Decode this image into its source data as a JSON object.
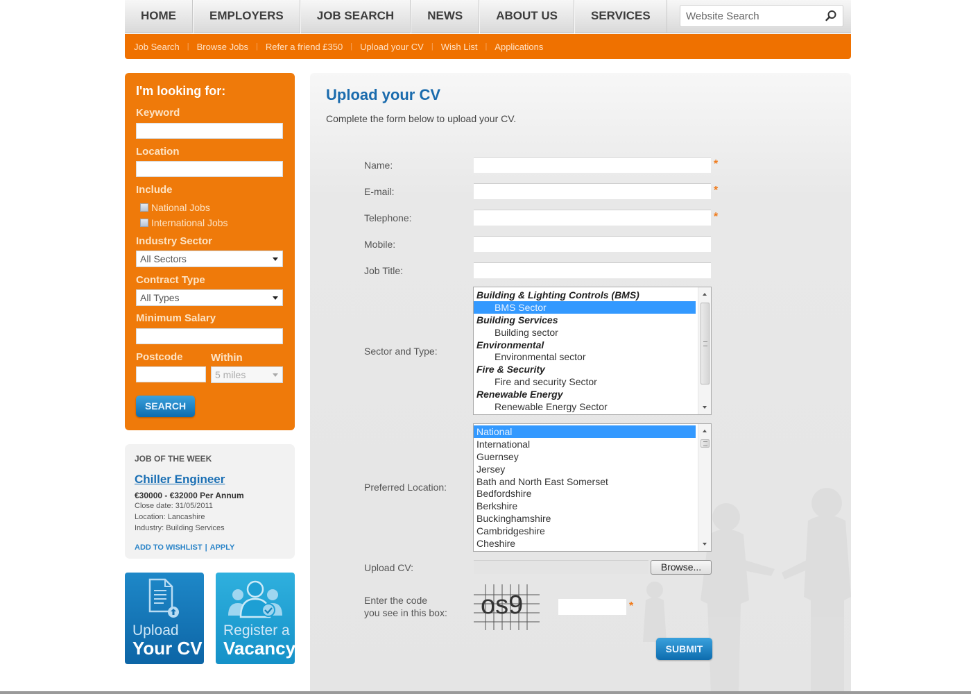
{
  "topnav": {
    "items": [
      {
        "label": "HOME"
      },
      {
        "label": "EMPLOYERS"
      },
      {
        "label": "JOB SEARCH"
      },
      {
        "label": "NEWS"
      },
      {
        "label": "ABOUT US"
      },
      {
        "label": "SERVICES"
      }
    ],
    "search": {
      "placeholder": "Website Search",
      "value": "",
      "icon": "search-icon"
    }
  },
  "subnav": {
    "items": [
      {
        "label": "Job Search"
      },
      {
        "label": "Browse Jobs"
      },
      {
        "label": "Refer a friend £350"
      },
      {
        "label": "Upload your CV"
      },
      {
        "label": "Wish List"
      },
      {
        "label": "Applications"
      }
    ]
  },
  "search_panel": {
    "title": "I'm looking for:",
    "keyword": {
      "label": "Keyword",
      "value": ""
    },
    "location": {
      "label": "Location",
      "value": ""
    },
    "include": {
      "label": "Include",
      "options": [
        {
          "label": "National Jobs",
          "checked": false
        },
        {
          "label": "International Jobs",
          "checked": false
        }
      ]
    },
    "industry_sector": {
      "label": "Industry Sector",
      "selected": "All Sectors"
    },
    "contract_type": {
      "label": "Contract Type",
      "selected": "All Types"
    },
    "minimum_salary": {
      "label": "Minimum Salary",
      "value": ""
    },
    "postcode": {
      "label": "Postcode",
      "value": ""
    },
    "within": {
      "label": "Within",
      "selected": "5 miles"
    },
    "search_button": "SEARCH"
  },
  "job_of_the_week": {
    "heading": "JOB OF THE WEEK",
    "title": "Chiller Engineer",
    "salary": "€30000 - €32000 Per Annum",
    "close_date": "Close date: 31/05/2011",
    "location": "Location: Lancashire",
    "industry": "Industry: Building Services",
    "add_to_wishlist": "ADD TO WISHLIST",
    "separator": "|",
    "apply": "APPLY"
  },
  "tiles": {
    "upload": {
      "line1": "Upload",
      "line2": "Your CV",
      "icon": "document-upload-icon"
    },
    "register": {
      "line1": "Register a",
      "line2": "Vacancy",
      "icon": "people-check-icon"
    }
  },
  "form": {
    "title": "Upload your CV",
    "intro": "Complete the form below to upload your CV.",
    "required_marker": "*",
    "fields": {
      "name": {
        "label": "Name:",
        "value": "",
        "required": true
      },
      "email": {
        "label": "E-mail:",
        "value": "",
        "required": true
      },
      "telephone": {
        "label": "Telephone:",
        "value": "",
        "required": true
      },
      "mobile": {
        "label": "Mobile:",
        "value": "",
        "required": false
      },
      "job_title": {
        "label": "Job Title:",
        "value": "",
        "required": false
      }
    },
    "sector": {
      "label": "Sector and Type:",
      "options": [
        {
          "label": "Building & Lighting Controls (BMS)",
          "group": true
        },
        {
          "label": "BMS Sector",
          "group": false,
          "selected": true
        },
        {
          "label": "Building Services",
          "group": true
        },
        {
          "label": "Building sector",
          "group": false
        },
        {
          "label": "Environmental",
          "group": true
        },
        {
          "label": "Environmental sector",
          "group": false
        },
        {
          "label": "Fire & Security",
          "group": true
        },
        {
          "label": "Fire and security Sector",
          "group": false
        },
        {
          "label": "Renewable Energy",
          "group": true
        },
        {
          "label": "Renewable Energy Sector",
          "group": false
        }
      ]
    },
    "location": {
      "label": "Preferred Location:",
      "options": [
        {
          "label": "National",
          "selected": true
        },
        {
          "label": "International"
        },
        {
          "label": "Guernsey"
        },
        {
          "label": "Jersey"
        },
        {
          "label": "Bath and North East Somerset"
        },
        {
          "label": "Bedfordshire"
        },
        {
          "label": "Berkshire"
        },
        {
          "label": "Buckinghamshire"
        },
        {
          "label": "Cambridgeshire"
        },
        {
          "label": "Cheshire"
        }
      ]
    },
    "upload": {
      "label": "Upload CV:",
      "value": "",
      "browse_button": "Browse..."
    },
    "captcha": {
      "label_line1": "Enter the code",
      "label_line2": "you see in this box:",
      "code": "os9",
      "value": "",
      "required": true
    },
    "submit_button": "SUBMIT"
  },
  "colors": {
    "brand_orange": "#ef7100",
    "brand_blue": "#1a6bad",
    "button_blue": "#0d6cae",
    "selection_blue": "#3399ff"
  }
}
